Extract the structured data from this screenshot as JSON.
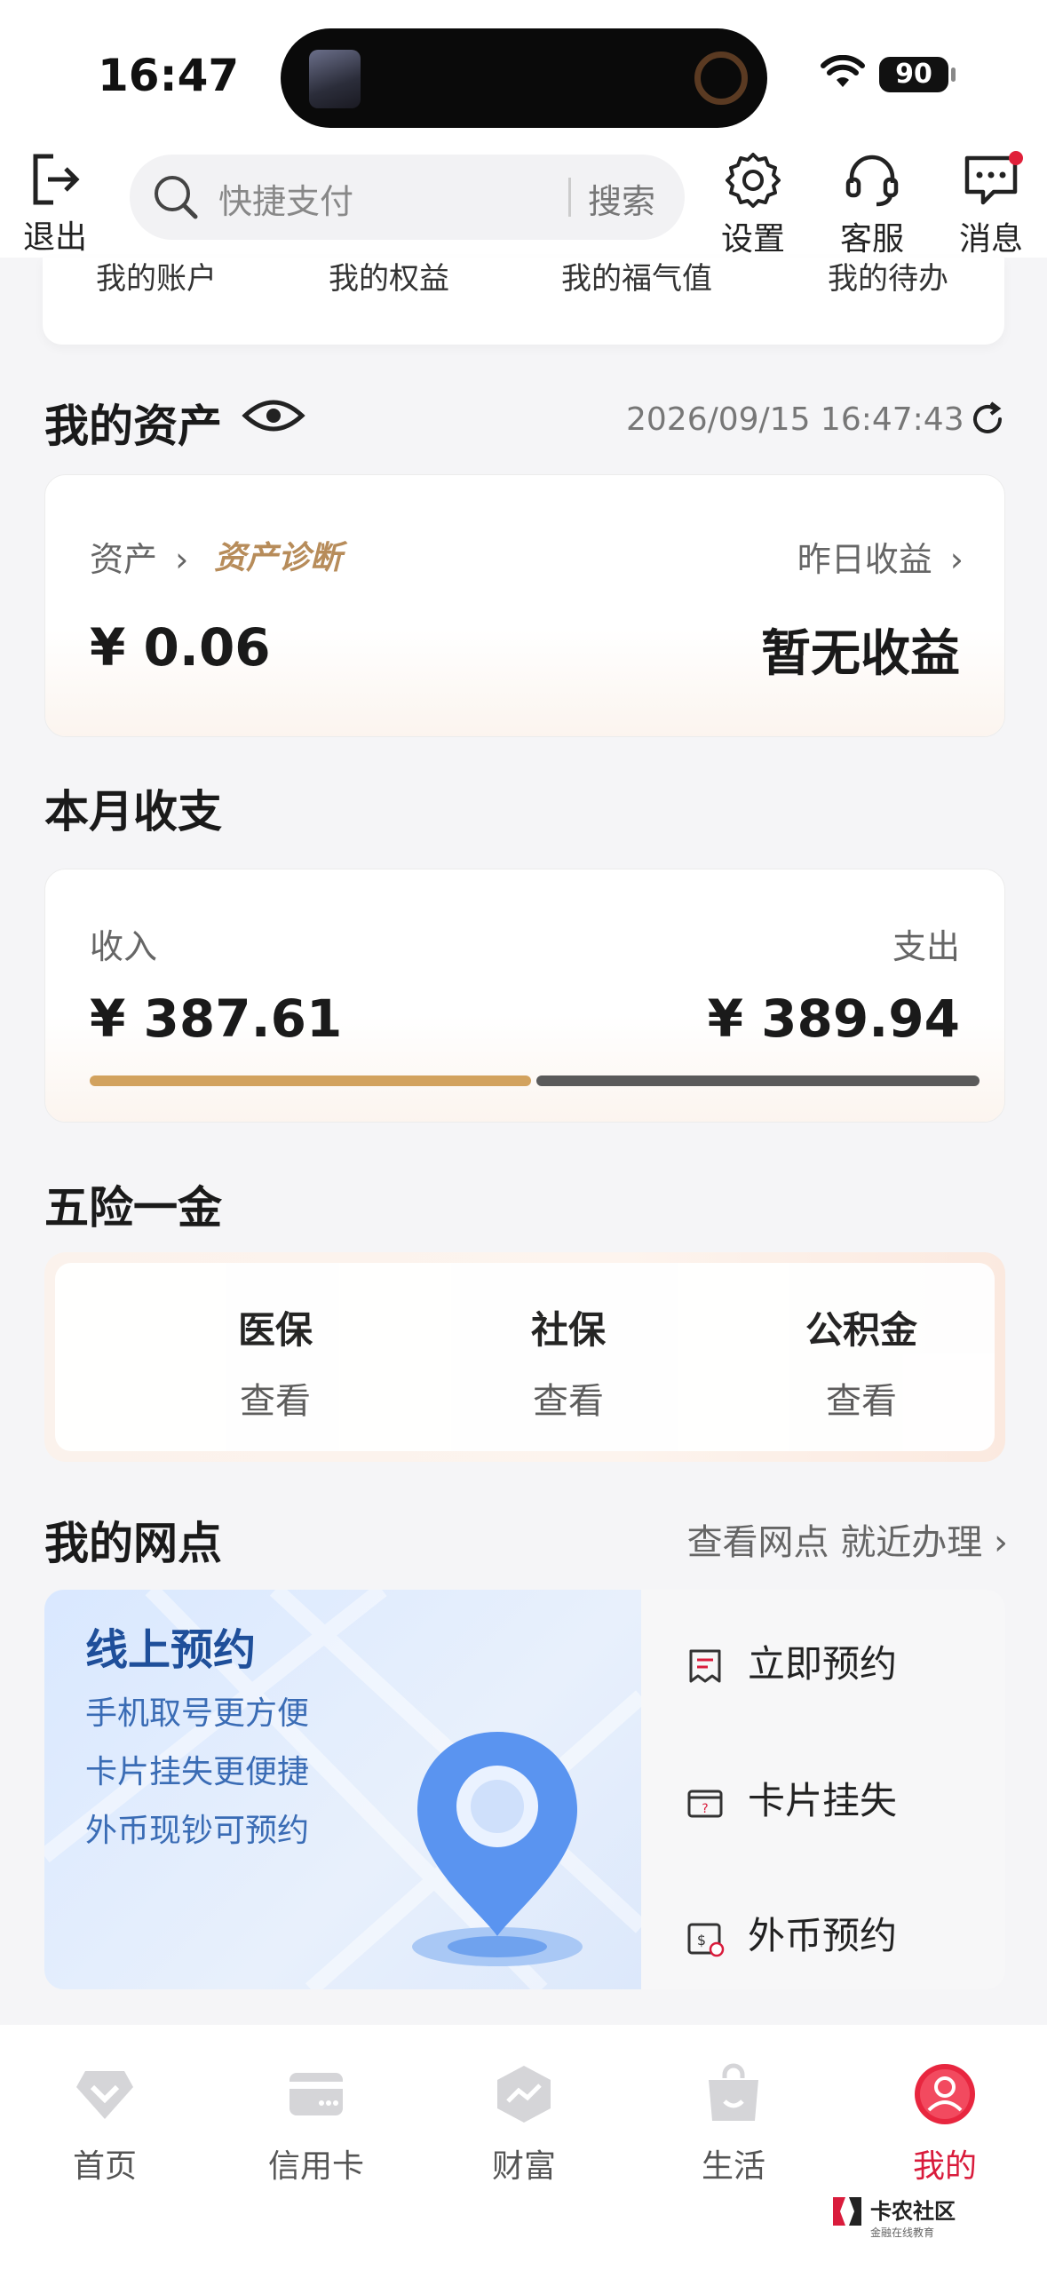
{
  "status": {
    "time": "16:47",
    "battery": "90"
  },
  "topnav": {
    "logout": "退出",
    "search_placeholder": "快捷支付",
    "search_button": "搜索",
    "settings": "设置",
    "service": "客服",
    "messages": "消息"
  },
  "account_row": [
    "我的账户",
    "我的权益",
    "我的福气值",
    "我的待办"
  ],
  "assets": {
    "title": "我的资产",
    "timestamp": "2026/09/15 16:47:43",
    "asset_label": "资产",
    "diagnosis": "资产诊断",
    "asset_value": "¥ 0.06",
    "yesterday_label": "昨日收益",
    "yesterday_value": "暂无收益"
  },
  "monthly": {
    "title": "本月收支",
    "income_label": "收入",
    "income_value": "¥ 387.61",
    "expense_label": "支出",
    "expense_value": "¥ 389.94",
    "income_ratio": 0.499
  },
  "welfare": {
    "title": "五险一金",
    "items": [
      {
        "label": "医保",
        "action": "查看"
      },
      {
        "label": "社保",
        "action": "查看"
      },
      {
        "label": "公积金",
        "action": "查看"
      }
    ]
  },
  "branch": {
    "title": "我的网点",
    "link": "查看网点 就近办理",
    "promo_title": "线上预约",
    "promo_lines": [
      "手机取号更方便",
      "卡片挂失更便捷",
      "外币现钞可预约"
    ],
    "actions": [
      "立即预约",
      "卡片挂失",
      "外币预约"
    ]
  },
  "tabs": [
    {
      "label": "首页",
      "icon": "home-diamond-icon"
    },
    {
      "label": "信用卡",
      "icon": "credit-card-icon"
    },
    {
      "label": "财富",
      "icon": "wealth-chart-icon"
    },
    {
      "label": "生活",
      "icon": "shopping-bag-icon"
    },
    {
      "label": "我的",
      "icon": "profile-icon",
      "active": true
    }
  ],
  "watermark": {
    "name": "卡农社区",
    "sub": "金融在线教育"
  },
  "colors": {
    "accent": "#d91c3c",
    "income_bar": "#d2a25e",
    "expense_bar": "#5a5a5a",
    "promo_blue": "#1f4f9a"
  }
}
